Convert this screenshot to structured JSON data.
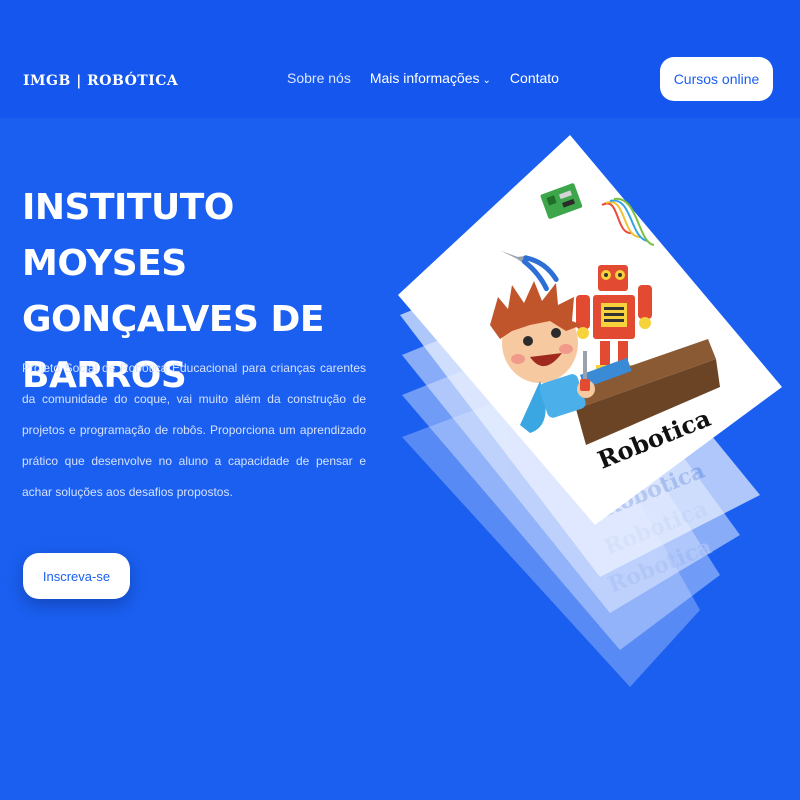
{
  "header": {
    "logo": "IMGB | ROBÓTICA",
    "nav": [
      {
        "label": "Sobre nós",
        "has_dropdown": false
      },
      {
        "label": "Mais informações",
        "has_dropdown": true
      },
      {
        "label": "Contato",
        "has_dropdown": false
      }
    ],
    "cta_label": "Cursos online"
  },
  "hero": {
    "title_lines": [
      "INSTITUTO MOYSES",
      "GONÇALVES DE",
      "BARROS"
    ],
    "description": "Projeto Social de Robótica Educacional para crianças carentes da comunidade do coque, vai muito além da construção de projetos e programação de robôs. Proporciona um aprendizado prático que desenvolve no aluno a capacidade de pensar e achar soluções aos desafios propostos.",
    "cta_label": "Inscreva-se"
  },
  "illustration": {
    "card_label": "Robotica",
    "icons": [
      "circuit-board-icon",
      "jumper-wires-icon",
      "pliers-icon",
      "robot-icon",
      "boy-with-screwdriver-icon",
      "workbench-icon"
    ]
  },
  "colors": {
    "background": "#1a5ff0",
    "header": "#1557ee",
    "button_bg": "#ffffff",
    "button_text": "#1a5ff0"
  }
}
